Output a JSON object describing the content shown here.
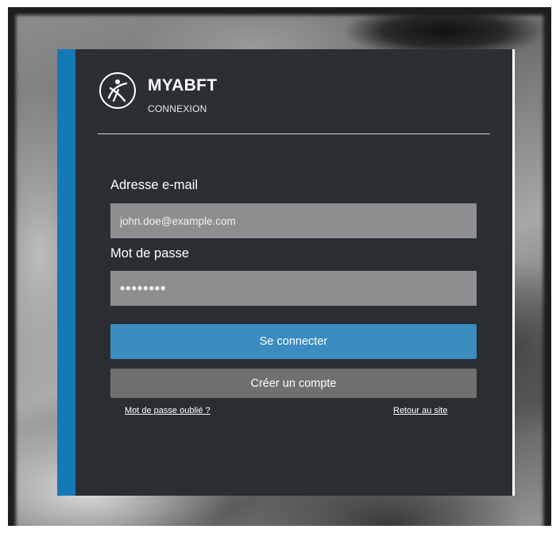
{
  "brand": {
    "logo_icon": "myabft-logo-icon",
    "name": "MYABFT",
    "subtitle": "CONNEXION"
  },
  "form": {
    "email_label": "Adresse e-mail",
    "email_value": "john.doe@example.com",
    "password_label": "Mot de passe",
    "password_value": "••••••••"
  },
  "buttons": {
    "login": "Se connecter",
    "create_account": "Créer un compte"
  },
  "links": {
    "forgot_password": "Mot de passe oublié ?",
    "back_to_site": "Retour au site"
  },
  "colors": {
    "accent": "#1579b5",
    "panel": "#2b2e33",
    "primary_button": "#3a8cc1",
    "secondary_button": "#707070",
    "input": "#8d8e90"
  }
}
